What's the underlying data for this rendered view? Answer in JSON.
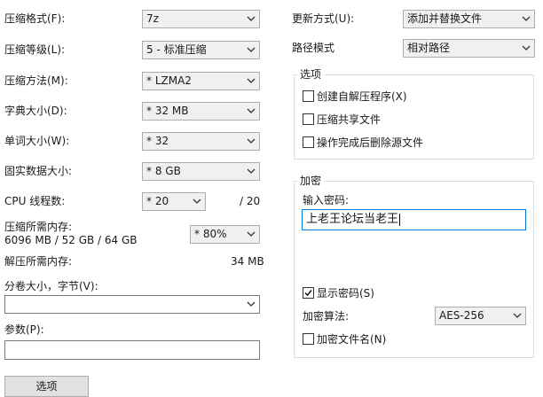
{
  "left": {
    "format": {
      "label": "压缩格式(F):",
      "value": "7z"
    },
    "level": {
      "label": "压缩等级(L):",
      "value": "5 - 标准压缩"
    },
    "method": {
      "label": "压缩方法(M):",
      "value": "*  LZMA2"
    },
    "dict": {
      "label": "字典大小(D):",
      "value": "*  32 MB"
    },
    "word": {
      "label": "单词大小(W):",
      "value": "*  32"
    },
    "solid": {
      "label": "固实数据大小:",
      "value": "*  8 GB"
    },
    "threads": {
      "label": "CPU 线程数:",
      "value": "*  20",
      "max": "/ 20"
    },
    "mem_compress": {
      "label": "压缩所需内存:",
      "detail": "6096 MB / 52 GB / 64 GB",
      "value": "*  80%"
    },
    "mem_decompress": {
      "label": "解压所需内存:",
      "value": "34 MB"
    },
    "split": {
      "label": "分卷大小，字节(V):",
      "value": ""
    },
    "params": {
      "label": "参数(P):",
      "value": ""
    },
    "options_button": "选项"
  },
  "right": {
    "update": {
      "label": "更新方式(U):",
      "value": "添加并替换文件"
    },
    "path": {
      "label": "路径模式",
      "value": "相对路径"
    },
    "options_group": {
      "title": "选项",
      "sfx": {
        "label": "创建自解压程序(X)",
        "checked": false
      },
      "shared": {
        "label": "压缩共享文件",
        "checked": false
      },
      "delete": {
        "label": "操作完成后删除源文件",
        "checked": false
      }
    },
    "encryption_group": {
      "title": "加密",
      "password_label": "输入密码:",
      "password_value": "上老王论坛当老王",
      "show_password": {
        "label": "显示密码(S)",
        "checked": true
      },
      "algo": {
        "label": "加密算法:",
        "value": "AES-256"
      },
      "encrypt_names": {
        "label": "加密文件名(N)",
        "checked": false
      }
    }
  }
}
